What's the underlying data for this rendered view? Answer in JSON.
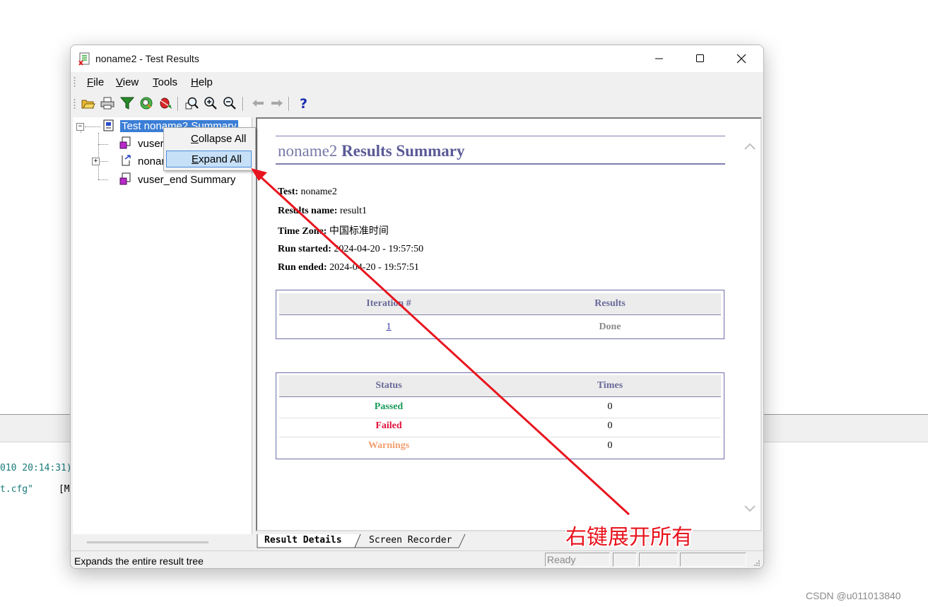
{
  "background": {
    "line1": "010 20:14:31)",
    "line2": "t.cfg\"",
    "line2_right": "[M"
  },
  "window": {
    "title": "noname2 - Test Results",
    "menu": [
      "File",
      "View",
      "Tools",
      "Help"
    ],
    "toolbar_icons": [
      "open-icon",
      "print-icon",
      "filter-icon",
      "find-icon",
      "bug-icon",
      "zoom-icon",
      "zoom-in-icon",
      "zoom-out-icon",
      "back-arrow-icon",
      "forward-arrow-icon",
      "help-icon"
    ]
  },
  "tree": {
    "root": "Test noname2 Summary",
    "child1": "vuser_init Summary",
    "child2": "noname2 Iteration",
    "child3": "vuser_end Summary"
  },
  "context_menu": {
    "collapse": "Collapse All",
    "expand": "Expand All"
  },
  "report": {
    "title_name": "noname2",
    "title_rest": "Results Summary",
    "test_label": "Test:",
    "test_value": "noname2",
    "results_label": "Results name:",
    "results_value": "result1",
    "tz_label": "Time Zone:",
    "tz_value": "中国标准时间",
    "started_label": "Run started:",
    "started_value": "2024-04-20 - 19:57:50",
    "ended_label": "Run ended:",
    "ended_value": "2024-04-20 - 19:57:51",
    "iter_table": {
      "headers": [
        "Iteration #",
        "Results"
      ],
      "rows": [
        {
          "iteration": "1",
          "result": "Done"
        }
      ]
    },
    "status_table": {
      "headers": [
        "Status",
        "Times"
      ],
      "rows": [
        {
          "status": "Passed",
          "times": "0",
          "color": "#1a9a5a"
        },
        {
          "status": "Failed",
          "times": "0",
          "color": "#e0143c"
        },
        {
          "status": "Warnings",
          "times": "0",
          "color": "#f0a070"
        }
      ]
    }
  },
  "tabs": [
    "Result Details",
    "Screen Recorder"
  ],
  "statusbar": {
    "text": "Expands the entire result tree",
    "ready": "Ready"
  },
  "annotation": "右键展开所有",
  "watermark": "CSDN @u011013840"
}
